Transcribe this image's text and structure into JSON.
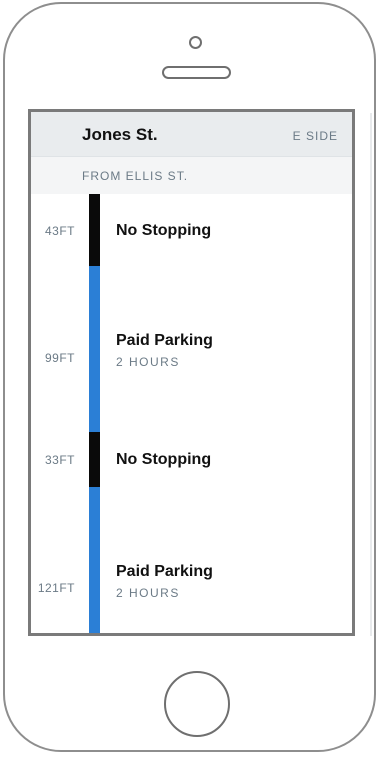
{
  "header": {
    "street": "Jones St.",
    "side": "E SIDE",
    "from": "FROM ELLIS ST."
  },
  "segments": [
    {
      "length": "43FT",
      "title": "No Stopping",
      "subtitle": "",
      "color": "#0a0a0a"
    },
    {
      "length": "99FT",
      "title": "Paid Parking",
      "subtitle": "2 HOURS",
      "color": "#2b7fd6"
    },
    {
      "length": "33FT",
      "title": "No Stopping",
      "subtitle": "",
      "color": "#0a0a0a"
    },
    {
      "length": "121FT",
      "title": "Paid Parking",
      "subtitle": "2 HOURS",
      "color": "#2b7fd6"
    }
  ]
}
